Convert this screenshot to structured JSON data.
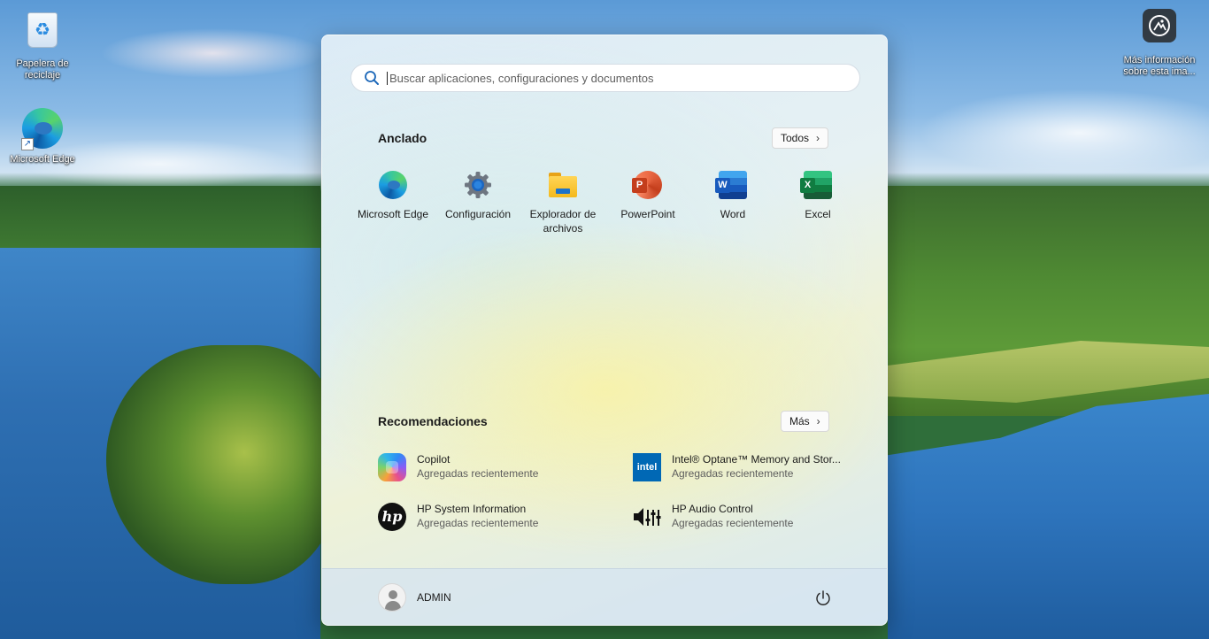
{
  "desktop": {
    "icons": [
      {
        "label": "Papelera de reciclaje",
        "icon": "recycle-bin-icon"
      },
      {
        "label": "Microsoft Edge",
        "icon": "edge-icon"
      },
      {
        "label": "Más información sobre esta ima...",
        "icon": "info-camera-icon"
      }
    ]
  },
  "start": {
    "search": {
      "placeholder": "Buscar aplicaciones, configuraciones y documentos",
      "icon": "search-icon"
    },
    "pinned": {
      "title": "Anclado",
      "all_button": "Todos",
      "items": [
        {
          "label": "Microsoft Edge",
          "icon": "edge-icon"
        },
        {
          "label": "Configuración",
          "icon": "gear-icon"
        },
        {
          "label": "Explorador de archivos",
          "icon": "folder-icon"
        },
        {
          "label": "PowerPoint",
          "icon": "powerpoint-icon"
        },
        {
          "label": "Word",
          "icon": "word-icon"
        },
        {
          "label": "Excel",
          "icon": "excel-icon"
        }
      ]
    },
    "recommended": {
      "title": "Recomendaciones",
      "more_button": "Más",
      "items": [
        {
          "name": "Copilot",
          "sub": "Agregadas recientemente",
          "icon": "copilot-icon"
        },
        {
          "name": "Intel® Optane™ Memory and Stor...",
          "sub": "Agregadas recientemente",
          "icon": "intel-icon",
          "icon_text": "intel"
        },
        {
          "name": "HP System Information",
          "sub": "Agregadas recientemente",
          "icon": "hp-icon",
          "icon_text": "hp"
        },
        {
          "name": "HP Audio Control",
          "sub": "Agregadas recientemente",
          "icon": "audio-control-icon"
        }
      ]
    },
    "footer": {
      "user": "ADMIN",
      "power_icon": "power-icon"
    }
  },
  "colors": {
    "accent": "#0067c0",
    "word": "#185abd",
    "excel": "#107c41",
    "powerpoint": "#c43e1c",
    "intel": "#0068b5"
  }
}
